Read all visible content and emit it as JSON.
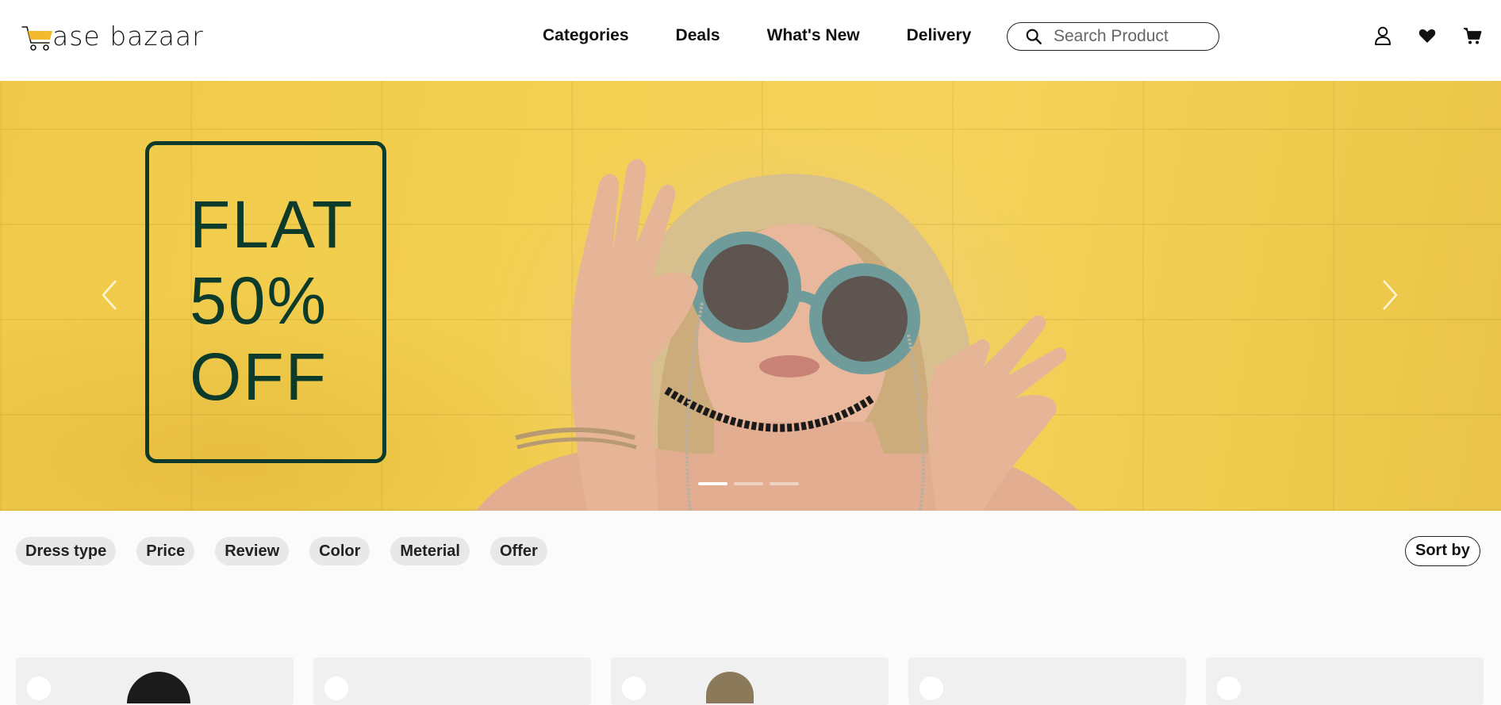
{
  "header": {
    "logo_text": "ase bazaar",
    "nav": [
      "Categories",
      "Deals",
      "What's New",
      "Delivery"
    ],
    "search_placeholder": "Search Product",
    "icons": [
      "user-icon",
      "heart-icon",
      "cart-icon"
    ]
  },
  "hero": {
    "promo_lines": [
      "FLAT",
      "50%",
      "OFF"
    ],
    "slide_count": 3,
    "active_slide": 1,
    "colors": {
      "promo_text": "#0c3b2b",
      "background": "#f3cf4f"
    }
  },
  "filters": {
    "chips": [
      "Dress type",
      "Price",
      "Review",
      "Color",
      "Meterial",
      "Offer"
    ],
    "sort_label": "Sort by"
  },
  "products": {
    "visible_cards": 5
  }
}
